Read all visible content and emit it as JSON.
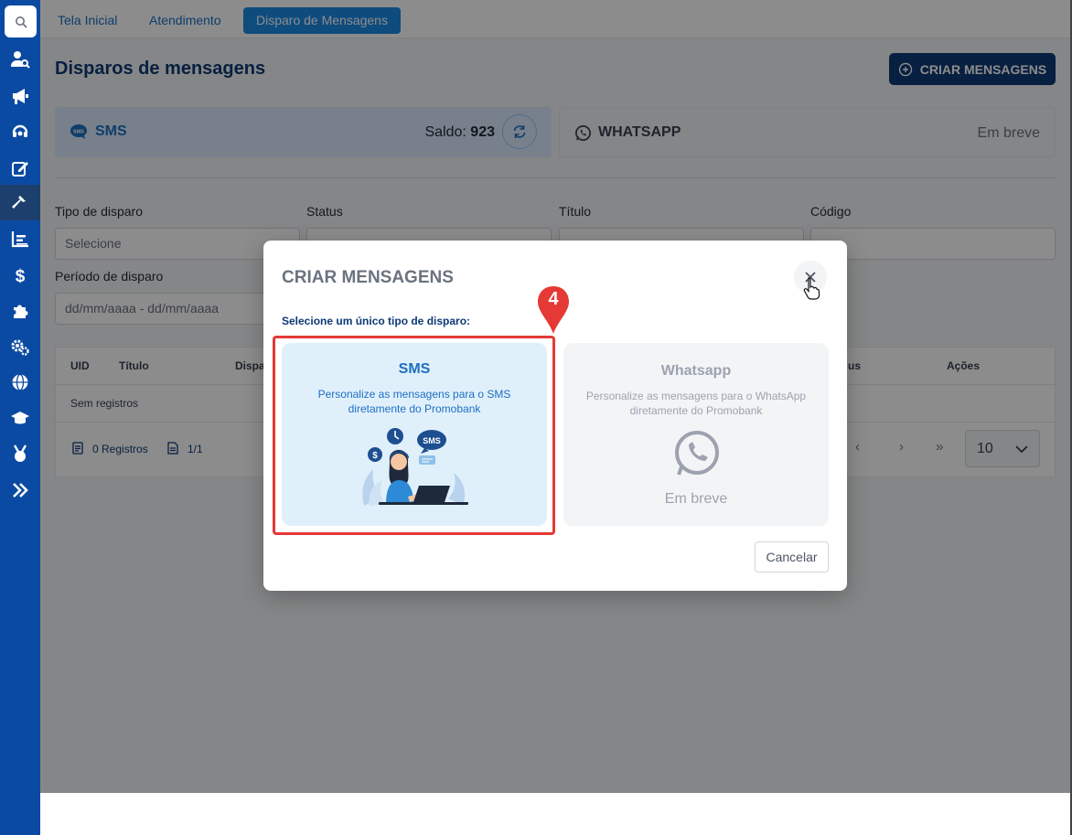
{
  "top_tabs": [
    {
      "label": "Tela Inicial"
    },
    {
      "label": "Atendimento"
    },
    {
      "label": "Disparo de Mensagens"
    }
  ],
  "page": {
    "title": "Disparos de mensagens",
    "create_button": "CRIAR MENSAGENS"
  },
  "channels": {
    "sms": {
      "name": "SMS",
      "balance_label": "Saldo:",
      "balance_value": "923"
    },
    "whatsapp": {
      "name": "WHATSAPP",
      "status": "Em breve"
    }
  },
  "filters": {
    "tipo_label": "Tipo de disparo",
    "tipo_placeholder": "Selecione",
    "status_label": "Status",
    "titulo_label": "Título",
    "codigo_label": "Código",
    "periodo_label": "Período de disparo",
    "periodo_placeholder": "dd/mm/aaaa - dd/mm/aaaa"
  },
  "table": {
    "headers": [
      "UID",
      "Título",
      "Dispa",
      "us",
      "Ações"
    ],
    "empty": "Sem registros",
    "registros": "0 Registros",
    "pages": "1/1",
    "page_size": "10"
  },
  "modal": {
    "title": "CRIAR MENSAGENS",
    "subtitle": "Selecione um único tipo de disparo:",
    "sms_card": {
      "title": "SMS",
      "description": "Personalize as mensagens para o SMS diretamente do Promobank"
    },
    "whatsapp_card": {
      "title": "Whatsapp",
      "description": "Personalize as mensagens para o WhatsApp diretamente do Promobank",
      "status": "Em breve"
    },
    "cancel": "Cancelar"
  },
  "annotation": {
    "step": "4"
  },
  "colors": {
    "brand": "#0b4aa2",
    "primary_dark": "#0d3a75",
    "accent": "#1a8ae6",
    "highlight": "#e53935"
  }
}
